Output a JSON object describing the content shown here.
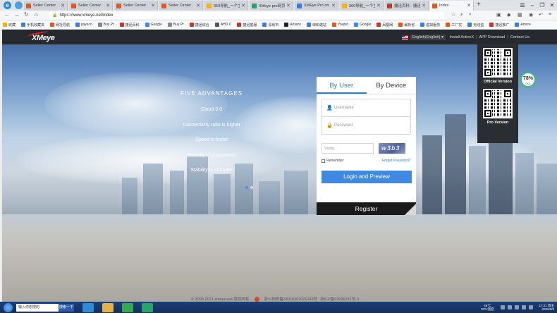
{
  "browser": {
    "tabs": [
      {
        "title": "Seller Center",
        "favicon_color": "#e8541e",
        "active": false
      },
      {
        "title": "Seller Center",
        "favicon_color": "#e8541e",
        "active": false
      },
      {
        "title": "Seller Center",
        "favicon_color": "#e8541e",
        "active": false
      },
      {
        "title": "Seller Center",
        "favicon_color": "#e8541e",
        "active": false
      },
      {
        "title": "360导航_一个主",
        "favicon_color": "#f2b705",
        "active": false
      },
      {
        "title": "XMeye pro网页",
        "favicon_color": "#1fa463",
        "active": false
      },
      {
        "title": "XMEye Pro on t",
        "favicon_color": "#3b7ddd",
        "active": false
      },
      {
        "title": "360导航_一个主",
        "favicon_color": "#f2b705",
        "active": false
      },
      {
        "title": "捷迅百科 - 捷迅",
        "favicon_color": "#c0392b",
        "active": false
      },
      {
        "title": "Index",
        "favicon_color": "#e8541e",
        "active": true
      }
    ],
    "url": "https://www.xmeye.net/index",
    "bookmarks": [
      {
        "label": "收藏",
        "color": "#f0b400"
      },
      {
        "label": "手机收藏夹",
        "color": "#3b7ddd"
      },
      {
        "label": "网址导航",
        "color": "#e8541e"
      },
      {
        "label": "jiayeco",
        "color": "#3b7ddd"
      },
      {
        "label": "Buy Pr",
        "color": "#888888"
      },
      {
        "label": "捷迅百科",
        "color": "#c0392b"
      },
      {
        "label": "Google",
        "color": "#4285f4"
      },
      {
        "label": "Buy Pr",
        "color": "#888888"
      },
      {
        "label": "捷迅综合",
        "color": "#c0392b"
      },
      {
        "label": "AHD C",
        "color": "#555555"
      },
      {
        "label": "捷迅客服",
        "color": "#c0392b"
      },
      {
        "label": "深圳市",
        "color": "#3b7ddd"
      },
      {
        "label": "Amazo",
        "color": "#222222"
      },
      {
        "label": "缔知建站",
        "color": "#3b7ddd"
      },
      {
        "label": "Youpin",
        "color": "#e8541e"
      },
      {
        "label": "Google",
        "color": "#4285f4"
      },
      {
        "label": "凤凰网",
        "color": "#c0392b"
      },
      {
        "label": "最新省",
        "color": "#e8541e"
      },
      {
        "label": "虚拟服务",
        "color": "#3b7ddd"
      },
      {
        "label": "工厂实",
        "color": "#e8541e"
      },
      {
        "label": "无线监",
        "color": "#3b7ddd"
      },
      {
        "label": "捷迅推广",
        "color": "#c0392b"
      },
      {
        "label": "Amcre",
        "color": "#3b7ddd"
      }
    ]
  },
  "site": {
    "logo": "XMeye",
    "language": "English(English)",
    "links": [
      "Install ActiveX",
      "APP Download",
      "Contact Us"
    ]
  },
  "features": {
    "heading": "FIVE ADVANTAGES",
    "items": [
      "Cloud 3.0",
      "Connectivity ratio is higher",
      "Speed is faster",
      "Security is guaranteed",
      "Stability is stronger"
    ]
  },
  "login": {
    "tab_user": "By User",
    "tab_device": "By Device",
    "username_placeholder": "Username",
    "password_placeholder": "Password",
    "verify_placeholder": "Verify",
    "captcha_text": "w3b3",
    "remember": "Remember",
    "forgot": "Forget Password?",
    "submit": "Login and Preview",
    "register": "Register"
  },
  "qr": {
    "official_label": "Official Version",
    "pro_label": "Pro Version"
  },
  "cpu_widget": {
    "value": "78%",
    "sub": "0K/s"
  },
  "footer": {
    "copyright": "© 2008-2021 xmeye.net 版权所有",
    "icp1": "浙公网安备33018302001246号",
    "icp2": "浙ICP备09096251号-3"
  },
  "taskbar": {
    "search_placeholder": "输入你想搜的",
    "search_button": "搜索一下",
    "temp": "46℃",
    "temp_label": "CPU温度",
    "time": "17:21 周五",
    "date": "2022/9/2"
  }
}
